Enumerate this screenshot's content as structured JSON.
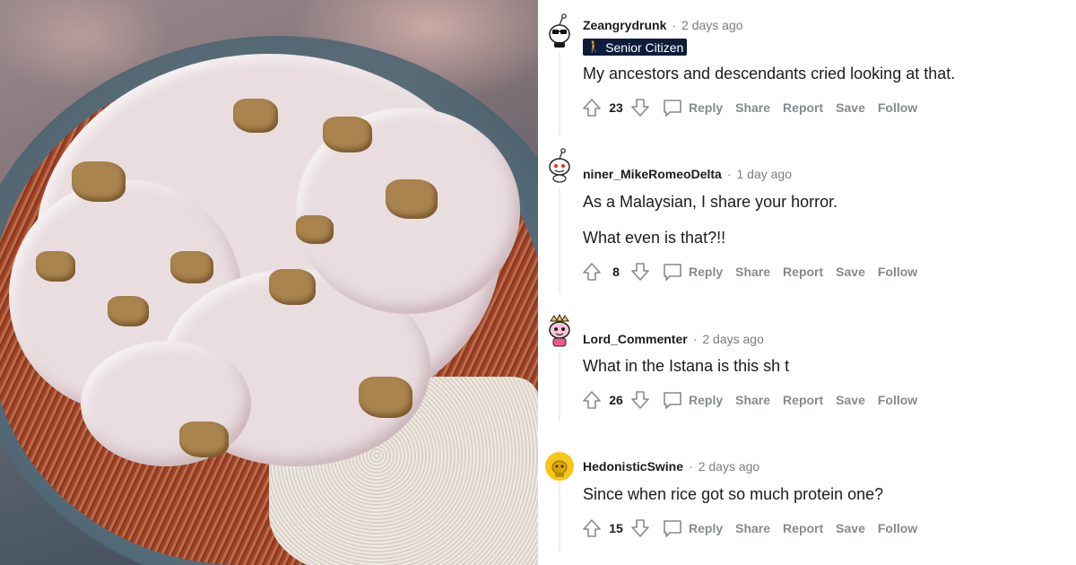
{
  "comments": [
    {
      "username": "Zeangrydrunk",
      "time": "2 days ago",
      "flair": "Senior Citizen",
      "body": [
        "My ancestors and descendants cried looking at that."
      ],
      "score": "23",
      "avatar_icon": "snoo-sunglasses-avatar",
      "avatar_bg": "#ffffff"
    },
    {
      "username": "niner_MikeRomeoDelta",
      "time": "1 day ago",
      "body": [
        "As a Malaysian, I share your horror.",
        "What even is that?!!"
      ],
      "score": "8",
      "avatar_icon": "snoo-default-avatar",
      "avatar_bg": "#ffffff"
    },
    {
      "username": "Lord_Commenter",
      "time": "2 days ago",
      "body": [
        "What in the Istana is this sh t"
      ],
      "score": "26",
      "avatar_icon": "snoo-pink-avatar",
      "avatar_bg": "#ffffff"
    },
    {
      "username": "HedonisticSwine",
      "time": "2 days ago",
      "body": [
        "Since when rice got so much protein one?"
      ],
      "score": "15",
      "avatar_icon": "snoo-yellow-avatar",
      "avatar_bg": "#f5c518"
    }
  ],
  "actions": {
    "reply": "Reply",
    "share": "Share",
    "report": "Report",
    "save": "Save",
    "follow": "Follow"
  },
  "separator": "·",
  "colors": {
    "flair_bg": "#0b1d3a",
    "action_text": "#878a8c",
    "meta_text": "#7c7c7c",
    "thread_line": "#edeff1"
  }
}
